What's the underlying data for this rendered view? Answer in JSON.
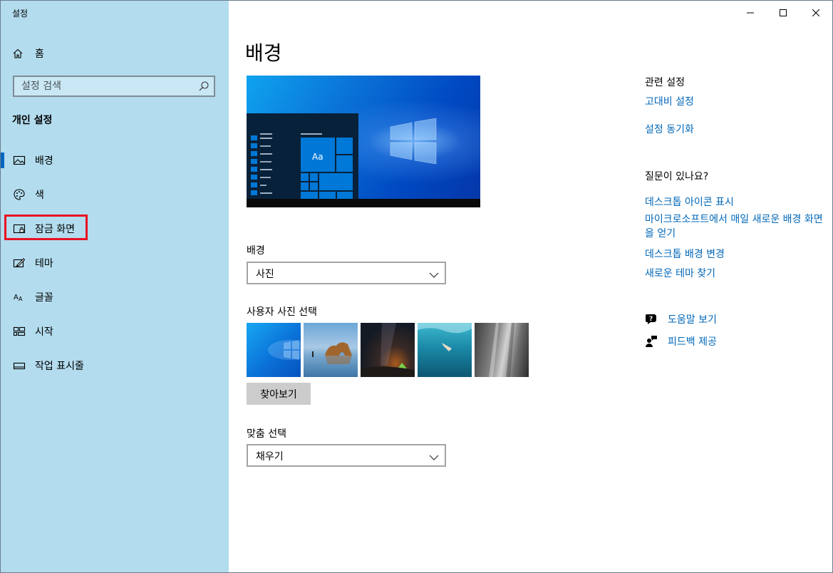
{
  "window": {
    "title": "설정"
  },
  "sidebar": {
    "home_label": "홈",
    "search_placeholder": "설정 검색",
    "section_title": "개인 설정",
    "items": [
      {
        "label": "배경",
        "icon": "picture-icon",
        "selected": true
      },
      {
        "label": "색",
        "icon": "palette-icon"
      },
      {
        "label": "잠금 화면",
        "icon": "lock-screen-icon",
        "highlighted": true
      },
      {
        "label": "테마",
        "icon": "theme-brush-icon"
      },
      {
        "label": "글꼴",
        "icon": "font-icon"
      },
      {
        "label": "시작",
        "icon": "start-tiles-icon"
      },
      {
        "label": "작업 표시줄",
        "icon": "taskbar-icon"
      }
    ]
  },
  "main": {
    "page_title": "배경",
    "preview": {
      "sample_text": "Aa"
    },
    "background_label": "배경",
    "background_value": "사진",
    "choose_photo_label": "사용자 사진 선택",
    "photos": [
      "windows-blue-wallpaper",
      "beach-rock-arch",
      "night-sky-tent",
      "underwater-swimmer",
      "rock-cliff"
    ],
    "browse_label": "찾아보기",
    "fit_label": "맞춤 선택",
    "fit_value": "채우기"
  },
  "related": {
    "related_title": "관련 설정",
    "high_contrast": "고대비 설정",
    "sync_settings": "설정 동기화",
    "question_title": "질문이 있나요?",
    "desktop_icons": "데스크톱 아이콘 표시",
    "daily_background": "마이크로소프트에서 매일 새로운 배경 화면을 얻기",
    "change_desktop_bg": "데스크톱 배경 변경",
    "find_themes": "새로운 테마 찾기",
    "get_help": "도움말 보기",
    "feedback": "피드백 제공"
  },
  "colors": {
    "accent": "#0067b8",
    "sidebar_bg": "#b3dcee",
    "highlight_box": "#e81123"
  }
}
